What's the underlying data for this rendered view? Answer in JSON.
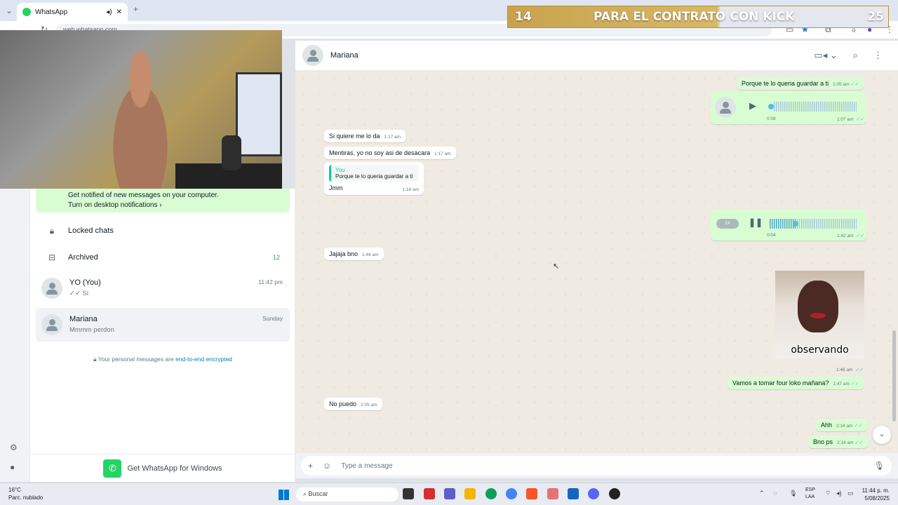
{
  "browser": {
    "tab_title": "WhatsApp",
    "url": "web.whatsapp.com"
  },
  "overlay": {
    "left_number": "14",
    "banner_text": "PARA EL CONTRATO CON KICK",
    "right_number": "25"
  },
  "sidebar": {
    "notification": {
      "line1": "Get notified of new messages on your computer.",
      "line2": "Turn on desktop notifications ›"
    },
    "locked_chats": "Locked chats",
    "archived": {
      "label": "Archived",
      "count": "12"
    },
    "chats": [
      {
        "name": "YO (You)",
        "last": "✓✓ Si",
        "time": "11:42 pm"
      },
      {
        "name": "Mariana",
        "last": "Mmmm perdon",
        "time": "Sunday"
      }
    ],
    "encryption_prefix": "Your personal messages are ",
    "encryption_link": "end-to-end encrypted",
    "get_app": "Get WhatsApp for Windows"
  },
  "conversation": {
    "contact": "Mariana",
    "messages": {
      "m1": {
        "text": "Porque te lo queria guardar a ti",
        "time": "1:05 am"
      },
      "voice1": {
        "duration": "0:08",
        "time": "1:07 am"
      },
      "m2": {
        "text": "Si quiere me lo da",
        "time": "1:17 am"
      },
      "m3": {
        "text": "Mentiras, yo no soy asi de desacara",
        "time": "1:17 am"
      },
      "m4": {
        "quote_author": "You",
        "quote_text": "Porque te lo queria guardar a ti",
        "text": "Jmm",
        "time": "1:18 am"
      },
      "voice2": {
        "speed": "1×",
        "elapsed": "0:04",
        "time": "1:42 am",
        "progress": 0.3
      },
      "m5": {
        "text": "Jajaja bno",
        "time": "1:44 am"
      },
      "sticker": {
        "caption": "observando",
        "time": "1:46 am"
      },
      "m6": {
        "text": "Vamos a tomar four loko mañana?",
        "time": "1:47 am"
      },
      "m7": {
        "text": "No puedo",
        "time": "2:05 am"
      },
      "m8": {
        "text": "Ahh",
        "time": "2:14 am"
      },
      "m9": {
        "text": "Bno ps",
        "time": "2:14 am"
      }
    },
    "composer_placeholder": "Type a message"
  },
  "taskbar": {
    "temperature": "16°C",
    "weather": "Parc. nublado",
    "search": "Buscar",
    "lang1": "ESP",
    "lang2": "LAA",
    "time": "11:44 p. m.",
    "date": "5/08/2025"
  },
  "colors": {
    "whatsapp_green": "#25d366",
    "outgoing_bubble": "#d9fdd3",
    "chat_background": "#efeae2",
    "read_ticks": "#53bdeb",
    "banner_gold": "#c9a24e"
  }
}
